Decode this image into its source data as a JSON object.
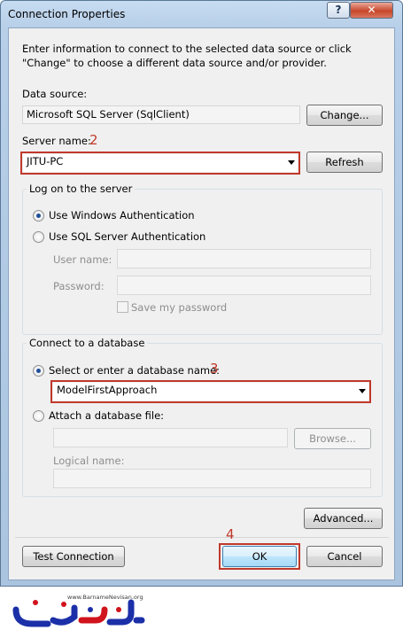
{
  "window": {
    "title": "Connection Properties",
    "help_glyph": "?",
    "close_glyph": "✕"
  },
  "intro": "Enter information to connect to the selected data source or click \"Change\" to choose a different data source and/or provider.",
  "data_source": {
    "label": "Data source:",
    "value": "Microsoft SQL Server (SqlClient)",
    "change_button": "Change..."
  },
  "server": {
    "label": "Server name:",
    "annotation": "2",
    "value": "JITU-PC",
    "refresh_button": "Refresh"
  },
  "logon": {
    "group_title": "Log on to the server",
    "windows_auth": "Use Windows Authentication",
    "sql_auth": "Use SQL Server Authentication",
    "selected": "windows",
    "user_name_label": "User name:",
    "password_label": "Password:",
    "save_password": "Save my password"
  },
  "database": {
    "group_title": "Connect to a database",
    "select_option": "Select or enter a database name:",
    "annotation": "3",
    "database_name": "ModelFirstApproach",
    "attach_option": "Attach a database file:",
    "browse_button": "Browse...",
    "logical_name_label": "Logical name:"
  },
  "advanced_button": "Advanced...",
  "buttons": {
    "test_connection": "Test Connection",
    "ok": "OK",
    "ok_annotation": "4",
    "cancel": "Cancel"
  },
  "watermark": {
    "url": "www.BarnameNevisan.org",
    "logo_text": "برنامه نویسان"
  },
  "colors": {
    "annotation_red": "#c0392b",
    "logo_blue": "#1b2fa8",
    "logo_red": "#d0131c"
  }
}
